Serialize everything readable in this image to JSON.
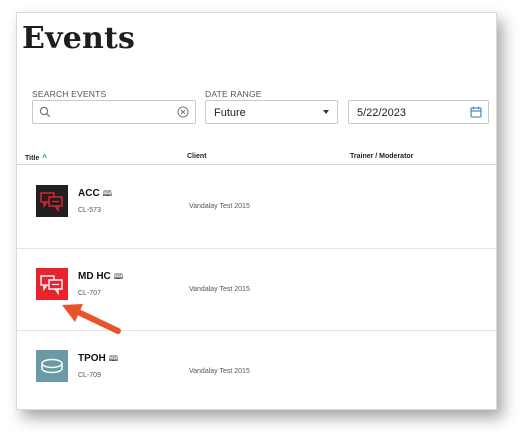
{
  "page": {
    "title": "Events"
  },
  "filters": {
    "search_label": "SEARCH EVENTS",
    "search_value": "",
    "date_range_label": "DATE RANGE",
    "date_range_value": "Future",
    "date_value": "5/22/2023"
  },
  "table": {
    "columns": [
      "Title",
      "Client",
      "Trainer / Moderator"
    ],
    "sorted_column": "Title",
    "sort_direction": "ascending",
    "rows": [
      {
        "title": "ACC",
        "code": "CL-573",
        "client": "Vandalay Test 2015",
        "trainer": "",
        "icon": "chat-bubbles-icon",
        "thumb_color": "#231f20",
        "icon_color": "#e8232f"
      },
      {
        "title": "MD HC",
        "code": "CL-707",
        "client": "Vandalay Test 2015",
        "trainer": "",
        "icon": "chat-bubbles-icon",
        "thumb_color": "#e8232f",
        "icon_color": "#ffffff"
      },
      {
        "title": "TPOH",
        "code": "CL-709",
        "client": "Vandalay Test 2015",
        "trainer": "",
        "icon": "disc-icon",
        "thumb_color": "#6a9aa6",
        "icon_color": "#ffffff"
      }
    ]
  },
  "annotation": {
    "icon": "arrow-icon",
    "color": "#e8532b"
  },
  "colors": {
    "accent": "#2a7fb8",
    "arrow": "#e8532b"
  }
}
